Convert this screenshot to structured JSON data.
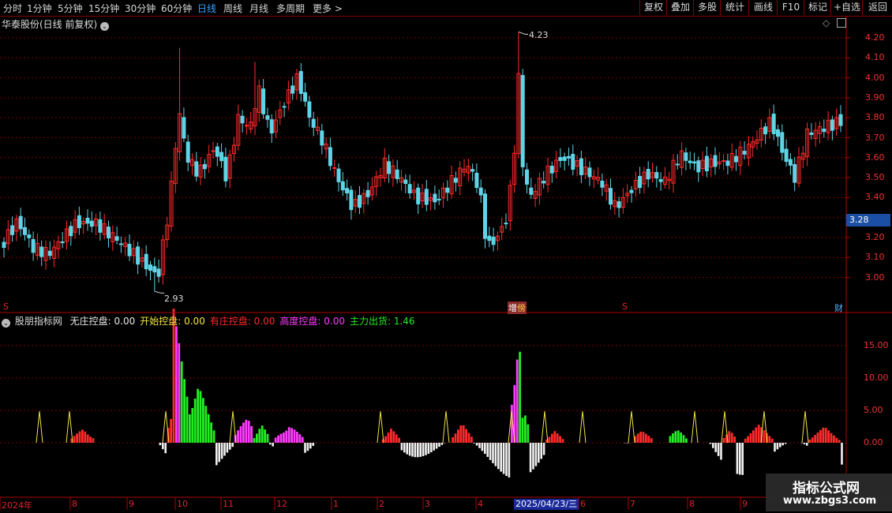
{
  "toolbar": {
    "periods": [
      "分时",
      "1分钟",
      "5分钟",
      "15分钟",
      "30分钟",
      "60分钟",
      "日线",
      "周线",
      "月线",
      "多周期",
      "更多 >"
    ],
    "active_period": "日线",
    "tools": [
      "复权",
      "叠加",
      "多股",
      "统计",
      "画线",
      "F10",
      "标记",
      "+自选",
      "返回"
    ]
  },
  "chart": {
    "title": "华泰股份(日线 前复权)",
    "price_ticks": [
      "4.20",
      "4.10",
      "4.00",
      "3.90",
      "3.80",
      "3.70",
      "3.60",
      "3.50",
      "3.40",
      "3.30",
      "3.20",
      "3.10",
      "3.00"
    ],
    "high_label": "4.23",
    "low_label": "2.93",
    "current_price": "3.28",
    "marker_zeng": "增",
    "marker_wei": "傍",
    "marker_cai": "财",
    "marker_s": "S"
  },
  "indicator": {
    "name": "股朋指标网",
    "items": [
      {
        "label": "无庄控盘:",
        "value": "0.00",
        "color": "#e8e8e8"
      },
      {
        "label": "开始控盘:",
        "value": "0.00",
        "color": "#f5e642"
      },
      {
        "label": "有庄控盘:",
        "value": "0.00",
        "color": "#ff2a2a"
      },
      {
        "label": "高度控盘:",
        "value": "0.00",
        "color": "#ff3cff"
      },
      {
        "label": "主力出货:",
        "value": "1.46",
        "color": "#22ee22"
      }
    ],
    "ticks": [
      "15.00",
      "10.00",
      "5.00",
      "0.00"
    ]
  },
  "xaxis": {
    "labels": [
      "2024年",
      "8",
      "9",
      "10",
      "11",
      "12",
      "1",
      "2",
      "3",
      "4",
      "6",
      "7",
      "8",
      "9"
    ],
    "cursor_date": "2025/04/23/三"
  },
  "watermark": {
    "line1": "指标公式网",
    "line2": "www.zbgs3.com"
  },
  "colors": {
    "up": "#ff2a2a",
    "down": "#5fd4e6",
    "grid": "#7a0000",
    "axis": "#b00000"
  }
}
